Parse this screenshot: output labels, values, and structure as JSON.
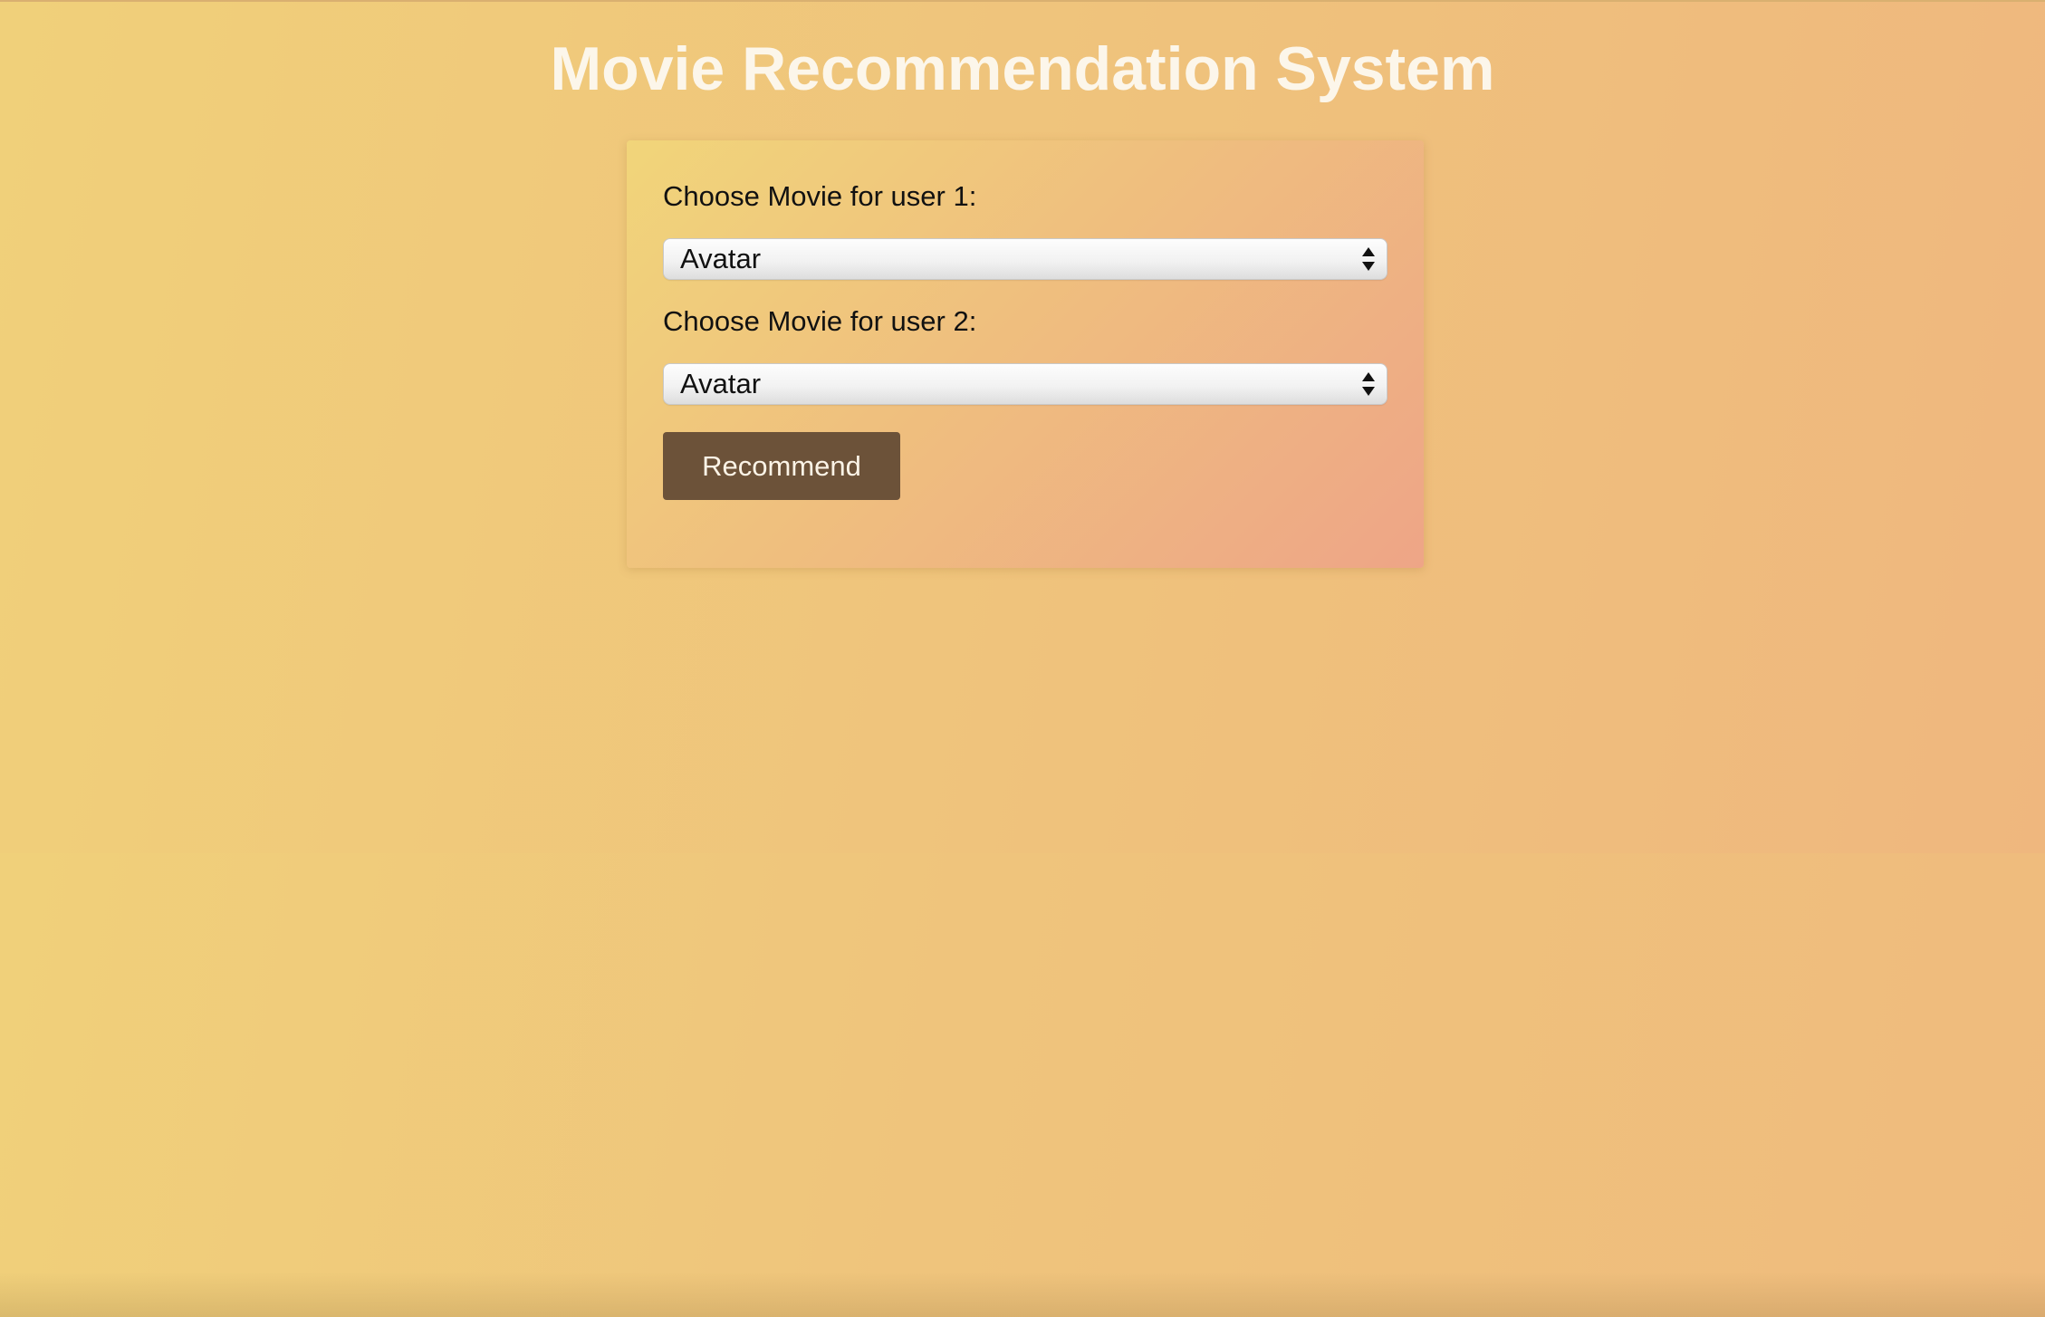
{
  "page": {
    "title": "Movie Recommendation System"
  },
  "form": {
    "user1": {
      "label": "Choose Movie for user 1:",
      "selected": "Avatar"
    },
    "user2": {
      "label": "Choose Movie for user 2:",
      "selected": "Avatar"
    },
    "submit_label": "Recommend"
  },
  "icons": {
    "select_arrows": "up-down-arrows-icon"
  },
  "colors": {
    "button_bg": "#6c5239",
    "button_text": "#fbf3e6",
    "title_text": "#fcf6ea",
    "background": "#efc47c"
  }
}
